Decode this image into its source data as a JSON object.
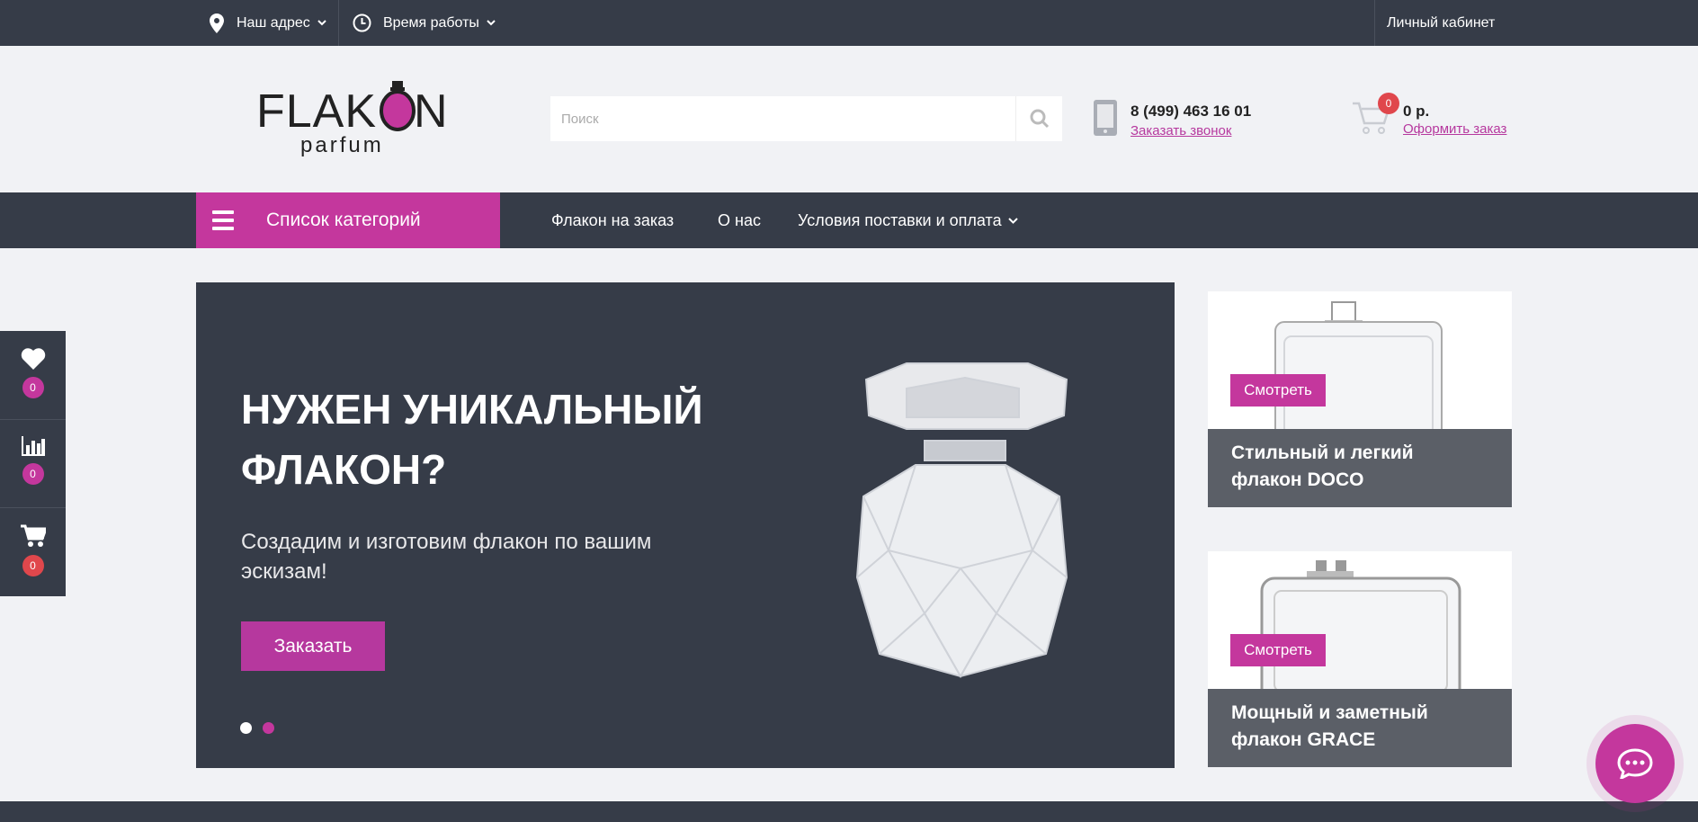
{
  "topbar": {
    "address_label": "Наш адрес",
    "hours_label": "Время работы",
    "account_label": "Личный кабинет"
  },
  "header": {
    "logo_main": "FLAKON",
    "logo_sub": "parfum",
    "search_placeholder": "Поиск",
    "phone": "8 (499) 463 16 01",
    "callback_label": "Заказать звонок",
    "cart_count": "0",
    "cart_sum": "0 р.",
    "checkout_label": "Оформить заказ"
  },
  "nav": {
    "categories_label": "Список категорий",
    "links": [
      "Флакон на заказ",
      "О нас",
      "Условия поставки и оплата"
    ]
  },
  "side_widget": {
    "favorites_count": "0",
    "compare_count": "0",
    "cart_count": "0"
  },
  "hero": {
    "title": "НУЖЕН УНИКАЛЬНЫЙ ФЛАКОН?",
    "subtitle": "Создадим и изготовим флакон по вашим эскизам!",
    "button_label": "Заказать",
    "slides_total": 2,
    "active_slide": 1
  },
  "promos": [
    {
      "tag": "Смотреть",
      "caption": "Стильный и легкий флакон DOCO"
    },
    {
      "tag": "Смотреть",
      "caption": "Мощный и заметный флакон GRACE"
    }
  ],
  "colors": {
    "brand": "#c4379d",
    "dark": "#363c48",
    "badge_red": "#e0474c"
  }
}
